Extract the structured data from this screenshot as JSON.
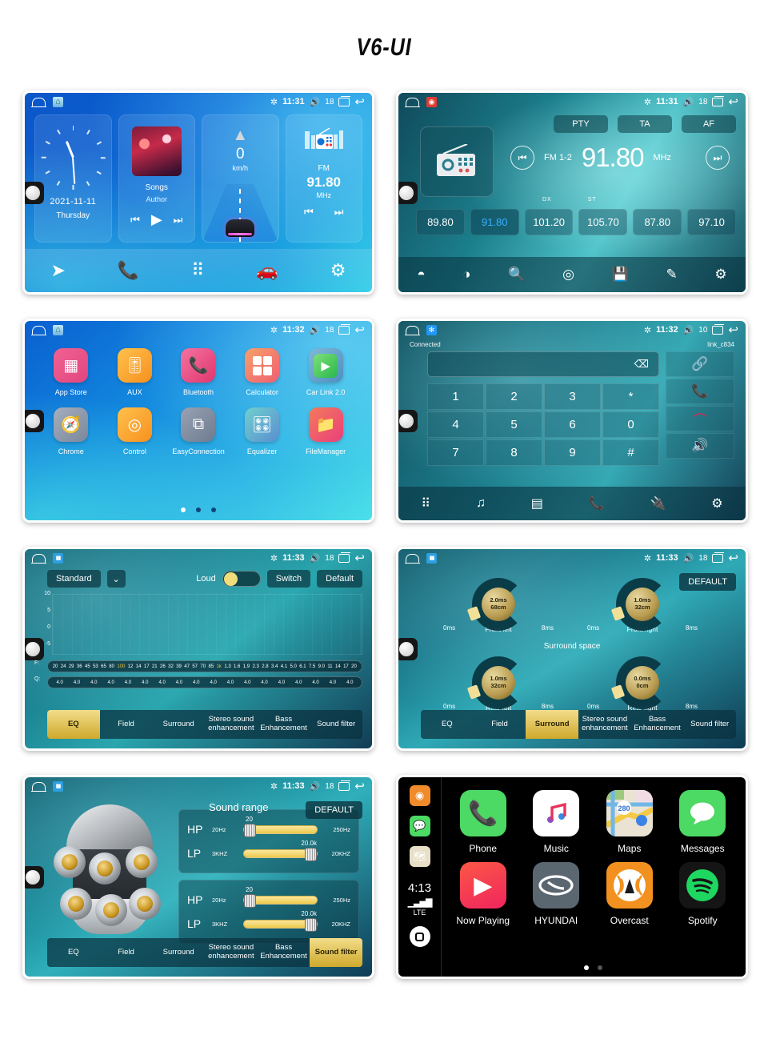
{
  "page": {
    "title": "V6-UI"
  },
  "screens": {
    "home": {
      "status": {
        "time": "11:31",
        "volume": "18",
        "bt_icon": "bluetooth-icon"
      },
      "clock": {
        "date": "2021-11-11",
        "day": "Thursday"
      },
      "music": {
        "title": "Songs",
        "author": "Author"
      },
      "navigation": {
        "speed": "0",
        "unit": "km/h"
      },
      "radio": {
        "band": "FM",
        "freq": "91.80",
        "unit": "MHz"
      },
      "dock": [
        "navigation-icon",
        "phone-icon",
        "apps-icon",
        "carplay-icon",
        "settings-icon"
      ]
    },
    "radio": {
      "status": {
        "time": "11:31",
        "volume": "18"
      },
      "rds_buttons": [
        "PTY",
        "TA",
        "AF"
      ],
      "band": "FM 1-2",
      "freq": "91.80",
      "unit": "MHz",
      "indicators": [
        "DX",
        "ST"
      ],
      "presets": [
        "89.80",
        "91.80",
        "101.20",
        "105.70",
        "87.80",
        "97.10"
      ],
      "active_preset_index": 1,
      "dock": [
        "replay-icon",
        "loudness-icon",
        "search-icon",
        "scan-icon",
        "save-icon",
        "edit-icon",
        "settings-icon"
      ]
    },
    "apps": {
      "status": {
        "time": "11:32",
        "volume": "18"
      },
      "row1": [
        {
          "label": "App Store",
          "icon": "grid-icon",
          "color": "#e2457f"
        },
        {
          "label": "AUX",
          "icon": "sliders-icon",
          "color": "#f7a02a"
        },
        {
          "label": "Bluetooth",
          "icon": "phone-icon",
          "color": "#e34d86"
        },
        {
          "label": "Calculator",
          "icon": "calculator-icon",
          "color": "#f06f5c"
        },
        {
          "label": "Car Link 2.0",
          "icon": "play-circle-icon",
          "color": "#5aa4cf"
        }
      ],
      "row2": [
        {
          "label": "Chrome",
          "icon": "compass-icon",
          "color": "#8f9bb0"
        },
        {
          "label": "Control",
          "icon": "steering-wheel-icon",
          "color": "#f7a02a"
        },
        {
          "label": "EasyConnection",
          "icon": "screen-mirror-icon",
          "color": "#7f8ba0"
        },
        {
          "label": "Equalizer",
          "icon": "equalizer-icon",
          "color": "#5fb8c8"
        },
        {
          "label": "FileManager",
          "icon": "folder-icon",
          "color": "#ef5a7a"
        }
      ],
      "page_dots": 3,
      "active_dot": 0
    },
    "dialer": {
      "status": {
        "time": "11:32",
        "volume": "10"
      },
      "connection_state": "Connected",
      "device_name": "link_c834",
      "input_value": "",
      "keys": [
        "1",
        "2",
        "3",
        "*",
        "4",
        "5",
        "6",
        "0",
        "7",
        "8",
        "9",
        "#"
      ],
      "side_buttons": [
        "link-icon",
        "call-answer-icon",
        "call-end-icon",
        "speaker-icon"
      ],
      "dock": [
        "keypad-icon",
        "music-icon",
        "contacts-icon",
        "call-log-icon",
        "bt-connect-icon",
        "settings-icon"
      ]
    },
    "eq": {
      "status": {
        "time": "11:33",
        "volume": "18"
      },
      "preset": "Standard",
      "loud_label": "Loud",
      "loud_on": true,
      "switch_label": "Switch",
      "default_label": "Default",
      "y_axis": [
        "10",
        "5",
        "0",
        "-5"
      ],
      "freq_label": "F:",
      "q_label": "Q:",
      "bands": [
        "20",
        "24",
        "29",
        "36",
        "45",
        "53",
        "65",
        "80",
        "100",
        "12",
        "14",
        "17",
        "21",
        "26",
        "32",
        "39",
        "47",
        "57",
        "70",
        "85",
        "1k",
        "1.3",
        "1.6",
        "1.9",
        "2.3",
        "2.8",
        "3.4",
        "4.1",
        "5.0",
        "6.1",
        "7.5",
        "9.0",
        "11",
        "14",
        "17",
        "20"
      ],
      "highlight_bands": [
        "100",
        "1k"
      ],
      "q_values": [
        "4.0",
        "4.0",
        "4.0",
        "4.0",
        "4.0",
        "4.0",
        "4.0",
        "4.0",
        "4.0",
        "4.0",
        "4.0",
        "4.0",
        "4.0",
        "4.0",
        "4.0",
        "4.0",
        "4.0",
        "4.0"
      ],
      "tabs": [
        "EQ",
        "Field",
        "Surround",
        "Stereo sound enhancement",
        "Bass Enhancement",
        "Sound filter"
      ],
      "active_tab": "EQ"
    },
    "surround": {
      "status": {
        "time": "11:33",
        "volume": "18"
      },
      "default_label": "DEFAULT",
      "section_title": "Surround space",
      "knobs": [
        {
          "name": "Front left",
          "delay": "2.0ms",
          "distance": "68cm",
          "min": "0ms",
          "max": "8ms"
        },
        {
          "name": "Front right",
          "delay": "1.0ms",
          "distance": "32cm",
          "min": "0ms",
          "max": "8ms"
        },
        {
          "name": "Rear left",
          "delay": "1.0ms",
          "distance": "32cm",
          "min": "0ms",
          "max": "8ms"
        },
        {
          "name": "Rear right",
          "delay": "0.0ms",
          "distance": "0cm",
          "min": "0ms",
          "max": "8ms"
        }
      ],
      "tabs": [
        "EQ",
        "Field",
        "Surround",
        "Stereo sound enhancement",
        "Bass Enhancement",
        "Sound filter"
      ],
      "active_tab": "Surround"
    },
    "filter": {
      "status": {
        "time": "11:33",
        "volume": "18"
      },
      "title": "Sound range",
      "default_label": "DEFAULT",
      "groups": [
        {
          "rows": [
            {
              "label": "HP",
              "min": "20Hz",
              "max": "250Hz",
              "value": "20"
            },
            {
              "label": "LP",
              "min": "3KHZ",
              "max": "20KHZ",
              "value": "20.0k"
            }
          ]
        },
        {
          "rows": [
            {
              "label": "HP",
              "min": "20Hz",
              "max": "250Hz",
              "value": "20"
            },
            {
              "label": "LP",
              "min": "3KHZ",
              "max": "20KHZ",
              "value": "20.0k"
            }
          ]
        }
      ],
      "tabs": [
        "EQ",
        "Field",
        "Surround",
        "Stereo sound enhancement",
        "Bass Enhancement",
        "Sound filter"
      ],
      "active_tab": "Sound filter"
    },
    "carplay": {
      "time": "4:13",
      "network": "LTE",
      "rail": [
        "overcast-icon",
        "messages-icon",
        "maps-icon"
      ],
      "row1": [
        {
          "label": "Phone",
          "icon": "phone-icon"
        },
        {
          "label": "Music",
          "icon": "music-note-icon"
        },
        {
          "label": "Maps",
          "icon": "maps-icon"
        },
        {
          "label": "Messages",
          "icon": "messages-icon"
        }
      ],
      "row2": [
        {
          "label": "Now Playing",
          "icon": "play-icon"
        },
        {
          "label": "HYUNDAI",
          "icon": "hyundai-logo-icon"
        },
        {
          "label": "Overcast",
          "icon": "overcast-icon"
        },
        {
          "label": "Spotify",
          "icon": "spotify-icon"
        }
      ],
      "page_dots": 2,
      "active_dot": 0
    }
  }
}
